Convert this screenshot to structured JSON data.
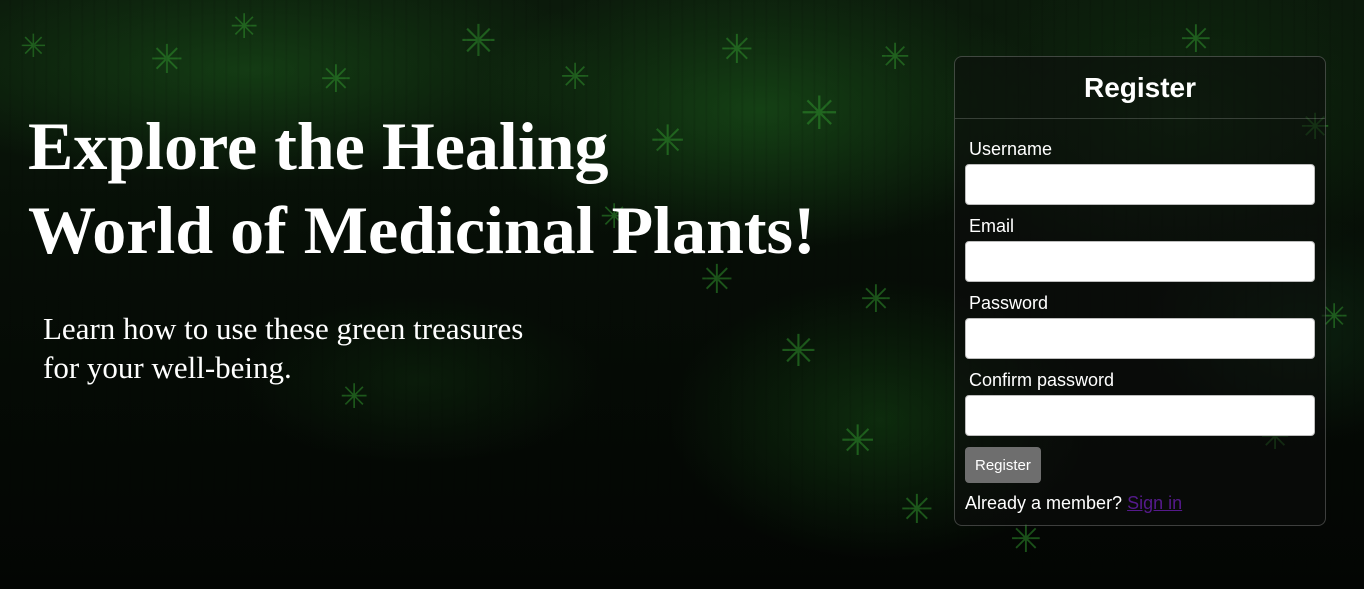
{
  "hero": {
    "title_line1": "Explore the Healing",
    "title_line2": "World of Medicinal Plants!",
    "subtitle_line1": "Learn how to use these green treasures",
    "subtitle_line2": "for your well-being."
  },
  "register_form": {
    "title": "Register",
    "fields": [
      {
        "label": "Username",
        "value": "",
        "type": "text"
      },
      {
        "label": "Email",
        "value": "",
        "type": "email"
      },
      {
        "label": "Password",
        "value": "",
        "type": "password"
      },
      {
        "label": "Confirm password",
        "value": "",
        "type": "password"
      }
    ],
    "submit_label": "Register",
    "member_prompt": "Already a member?",
    "signin_link": "Sign in"
  },
  "colors": {
    "text": "#ffffff",
    "link": "#551a8b",
    "button_bg": "#6e6e6e",
    "leaf_green": "#2f8f2c"
  }
}
